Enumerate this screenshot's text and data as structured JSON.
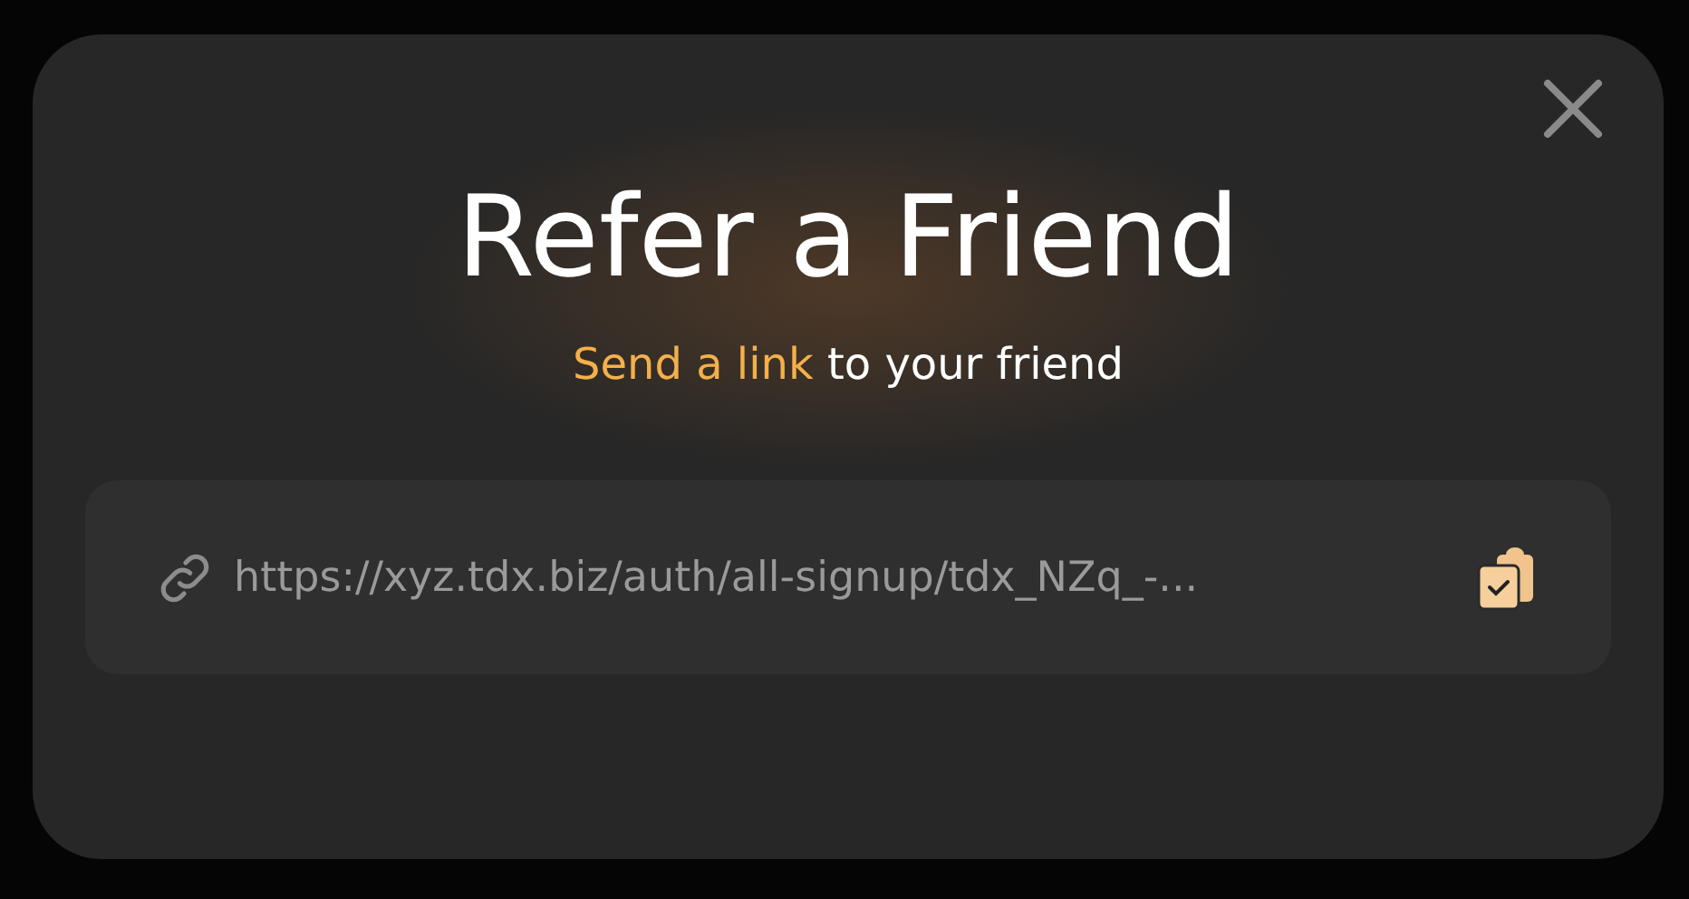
{
  "dialog": {
    "title": "Refer a Friend",
    "subtitle": {
      "link": "Send a link",
      "text": "to your friend"
    },
    "referral_link": "https://xyz.tdx.biz/auth/all-signup/tdx_NZq_-..."
  }
}
